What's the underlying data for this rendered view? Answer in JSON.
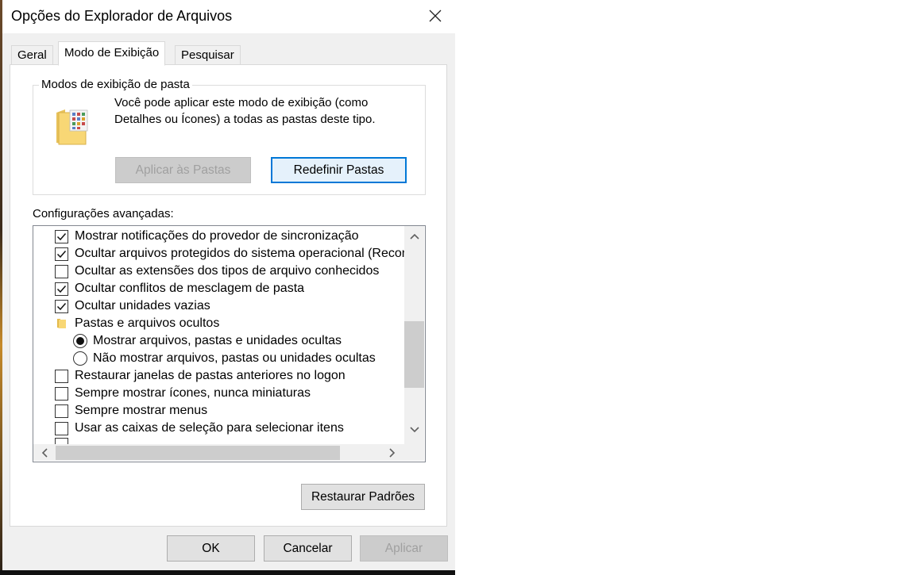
{
  "window": {
    "title": "Opções do Explorador de Arquivos"
  },
  "tabs": [
    {
      "label": "Geral"
    },
    {
      "label": "Modo de Exibição"
    },
    {
      "label": "Pesquisar"
    }
  ],
  "folder_views": {
    "legend": "Modos de exibição de pasta",
    "description": "Você pode aplicar este modo de exibição (como Detalhes ou Ícones) a todas as pastas deste tipo.",
    "apply_button": "Aplicar às Pastas",
    "reset_button": "Redefinir Pastas"
  },
  "advanced": {
    "label": "Configurações avançadas:",
    "items": [
      {
        "type": "checkbox",
        "checked": true,
        "label": "Mostrar notificações do provedor de sincronização"
      },
      {
        "type": "checkbox",
        "checked": true,
        "label": "Ocultar arquivos protegidos do sistema operacional (Recomendado)"
      },
      {
        "type": "checkbox",
        "checked": false,
        "label": "Ocultar as extensões dos tipos de arquivo conhecidos"
      },
      {
        "type": "checkbox",
        "checked": true,
        "label": "Ocultar conflitos de mesclagem de pasta"
      },
      {
        "type": "checkbox",
        "checked": true,
        "label": "Ocultar unidades vazias"
      },
      {
        "type": "folder",
        "label": "Pastas e arquivos ocultos"
      },
      {
        "type": "radio",
        "checked": true,
        "label": "Mostrar arquivos, pastas e unidades ocultas"
      },
      {
        "type": "radio",
        "checked": false,
        "label": "Não mostrar arquivos, pastas ou unidades ocultas"
      },
      {
        "type": "checkbox",
        "checked": false,
        "label": "Restaurar janelas de pastas anteriores no logon"
      },
      {
        "type": "checkbox",
        "checked": false,
        "label": "Sempre mostrar ícones, nunca miniaturas"
      },
      {
        "type": "checkbox",
        "checked": false,
        "label": "Sempre mostrar menus"
      },
      {
        "type": "checkbox",
        "checked": false,
        "label": "Usar as caixas de seleção para selecionar itens"
      }
    ]
  },
  "restore_defaults_button": "Restaurar Padrões",
  "footer": {
    "ok": "OK",
    "cancel": "Cancelar",
    "apply": "Aplicar"
  },
  "icons": [
    "close-icon",
    "folder-view-icon",
    "folder-icon",
    "check-icon",
    "chevron-up-icon",
    "chevron-down-icon",
    "chevron-left-icon",
    "chevron-right-icon"
  ]
}
